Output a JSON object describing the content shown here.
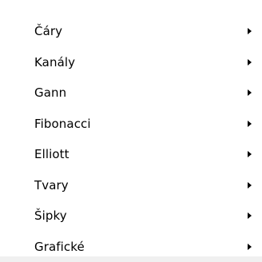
{
  "menu": {
    "items": [
      {
        "label": "Čáry",
        "icon": "submenu-arrow-icon"
      },
      {
        "label": "Kanály",
        "icon": "submenu-arrow-icon"
      },
      {
        "label": "Gann",
        "icon": "submenu-arrow-icon"
      },
      {
        "label": "Fibonacci",
        "icon": "submenu-arrow-icon"
      },
      {
        "label": "Elliott",
        "icon": "submenu-arrow-icon"
      },
      {
        "label": "Tvary",
        "icon": "submenu-arrow-icon"
      },
      {
        "label": "Šipky",
        "icon": "submenu-arrow-icon"
      },
      {
        "label": "Grafické",
        "icon": "submenu-arrow-icon"
      }
    ]
  }
}
